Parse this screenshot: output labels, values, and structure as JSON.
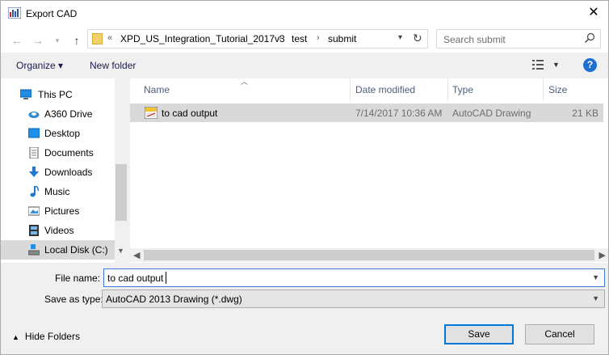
{
  "window": {
    "title": "Export CAD",
    "close_glyph": "✕"
  },
  "address": {
    "overflow": "«",
    "crumbs": [
      "XPD_US_Integration_Tutorial_2017v3",
      "test",
      "submit"
    ],
    "separator": "›"
  },
  "search": {
    "placeholder": "Search submit"
  },
  "toolbar": {
    "organize_label": "Organize ▾",
    "new_folder_label": "New folder",
    "help_label": "?"
  },
  "nav": {
    "items": [
      {
        "label": "This PC",
        "icon": "computer-icon"
      },
      {
        "label": "A360 Drive",
        "icon": "cloud-drive-icon"
      },
      {
        "label": "Desktop",
        "icon": "desktop-icon"
      },
      {
        "label": "Documents",
        "icon": "documents-icon"
      },
      {
        "label": "Downloads",
        "icon": "downloads-icon"
      },
      {
        "label": "Music",
        "icon": "music-icon"
      },
      {
        "label": "Pictures",
        "icon": "pictures-icon"
      },
      {
        "label": "Videos",
        "icon": "videos-icon"
      },
      {
        "label": "Local Disk (C:)",
        "icon": "disk-icon"
      }
    ],
    "selected": "Local Disk (C:)"
  },
  "filelist": {
    "columns": [
      "Name",
      "Date modified",
      "Type",
      "Size"
    ],
    "rows": [
      {
        "name": "to cad output",
        "date": "7/14/2017 10:36 AM",
        "type": "AutoCAD Drawing",
        "size": "21 KB"
      }
    ]
  },
  "form": {
    "filename_label": "File name:",
    "filename_value": "to cad output",
    "savetype_label": "Save as type:",
    "savetype_value": "AutoCAD 2013 Drawing (*.dwg)"
  },
  "footer": {
    "hide_folders_label": "Hide Folders",
    "save_label": "Save",
    "cancel_label": "Cancel"
  },
  "colors": {
    "accent": "#0078d7",
    "selection": "#d9d9d9",
    "header_text": "#4c607a",
    "help_blue": "#1d6fd6"
  }
}
